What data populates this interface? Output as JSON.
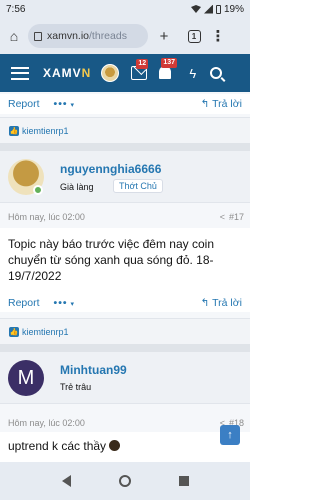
{
  "status": {
    "time": "7:56",
    "battery": "19%"
  },
  "browser": {
    "url_host": "xamvn.io",
    "url_path": "/threads",
    "tab_count": "1"
  },
  "nav": {
    "logo_a": "XAMV",
    "logo_b": "N",
    "inbox_count": "12",
    "alerts_count": "137"
  },
  "post_top": {
    "report": "Report",
    "more": "•••",
    "reply": "Trả lời",
    "liker": "kiemtienrp1"
  },
  "post1": {
    "username": "nguyennghia6666",
    "rank": "Già làng",
    "badge": "Thớt Chủ",
    "time": "Hôm nay, lúc 02:00",
    "number": "#17",
    "text": "Topic này báo trước việc đêm nay coin chuyển từ sóng xanh qua sóng đỏ. 18-19/7/2022",
    "report": "Report",
    "more": "•••",
    "reply": "Trả lời",
    "liker": "kiemtienrp1"
  },
  "post2": {
    "avatar_letter": "M",
    "username": "Minhtuan99",
    "rank": "Trẻ trâu",
    "time": "Hôm nay, lúc 02:00",
    "number": "#18",
    "text": "uptrend k các thầy"
  }
}
